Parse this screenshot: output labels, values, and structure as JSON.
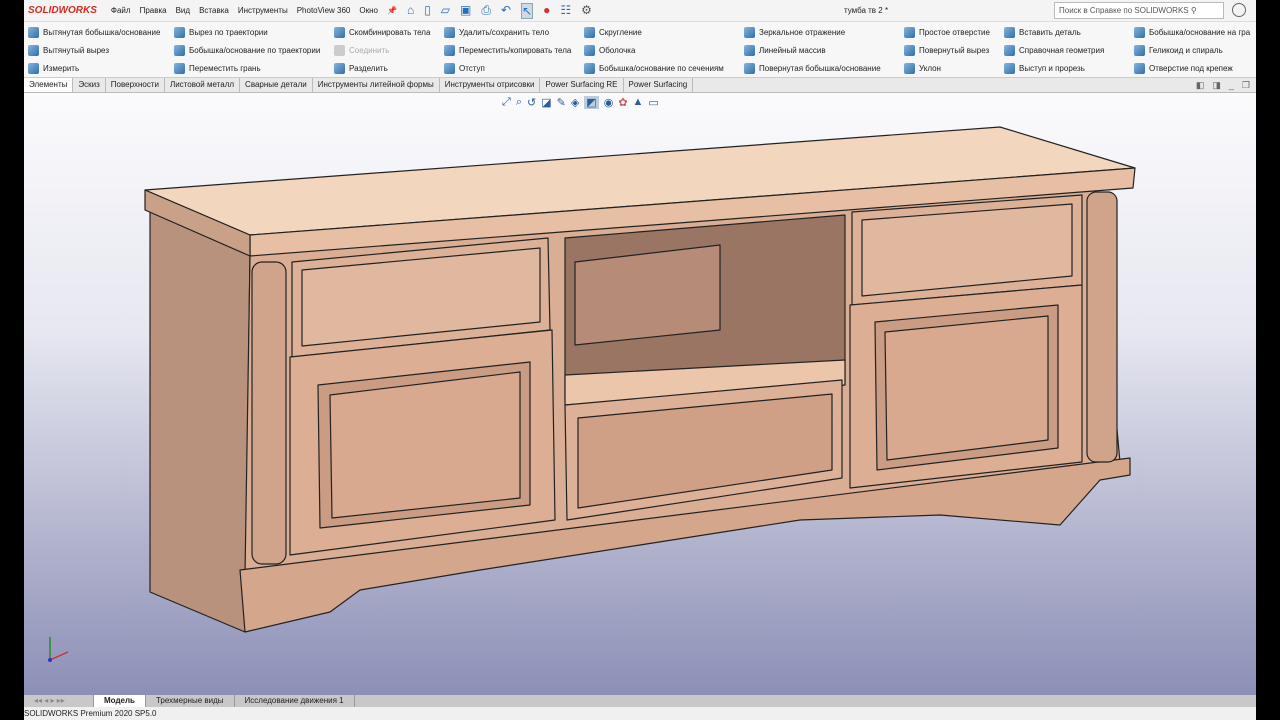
{
  "app": {
    "logo": "SOLIDWORKS",
    "title": "тумба тв 2 *"
  },
  "menu": [
    "Файл",
    "Правка",
    "Вид",
    "Вставка",
    "Инструменты",
    "PhotoView 360",
    "Окно"
  ],
  "search": {
    "placeholder": "Поиск в Справке по SOLIDWORKS"
  },
  "ribbon": [
    {
      "label": "Вытянутая бобышка/основание",
      "col": 0,
      "row": 0
    },
    {
      "label": "Вытянутый вырез",
      "col": 0,
      "row": 1
    },
    {
      "label": "Измерить",
      "col": 0,
      "row": 2
    },
    {
      "label": "Вырез по траектории",
      "col": 1,
      "row": 0
    },
    {
      "label": "Бобышка/основание по траектории",
      "col": 1,
      "row": 1
    },
    {
      "label": "Переместить грань",
      "col": 1,
      "row": 2
    },
    {
      "label": "Скомбинировать тела",
      "col": 2,
      "row": 0
    },
    {
      "label": "Соединить",
      "col": 2,
      "row": 1,
      "disabled": true
    },
    {
      "label": "Разделить",
      "col": 2,
      "row": 2
    },
    {
      "label": "Удалить/сохранить тело",
      "col": 3,
      "row": 0
    },
    {
      "label": "Переместить/копировать тела",
      "col": 3,
      "row": 1
    },
    {
      "label": "Отступ",
      "col": 3,
      "row": 2
    },
    {
      "label": "Скругление",
      "col": 4,
      "row": 0
    },
    {
      "label": "Оболочка",
      "col": 4,
      "row": 1
    },
    {
      "label": "Бобышка/основание по сечениям",
      "col": 4,
      "row": 2
    },
    {
      "label": "Зеркальное отражение",
      "col": 5,
      "row": 0
    },
    {
      "label": "Линейный массив",
      "col": 5,
      "row": 1
    },
    {
      "label": "Повернутая бобышка/основание",
      "col": 5,
      "row": 2
    },
    {
      "label": "Простое отверстие",
      "col": 6,
      "row": 0
    },
    {
      "label": "Повернутый вырез",
      "col": 6,
      "row": 1
    },
    {
      "label": "Уклон",
      "col": 6,
      "row": 2
    },
    {
      "label": "Вставить деталь",
      "col": 7,
      "row": 0
    },
    {
      "label": "Справочная геометрия",
      "col": 7,
      "row": 1
    },
    {
      "label": "Выступ и прорезь",
      "col": 7,
      "row": 2
    },
    {
      "label": "Бобышка/основание на гра",
      "col": 8,
      "row": 0
    },
    {
      "label": "Геликоид и спираль",
      "col": 8,
      "row": 1
    },
    {
      "label": "Отверстие под крепеж",
      "col": 8,
      "row": 2
    }
  ],
  "tabs": [
    "Элементы",
    "Эскиз",
    "Поверхности",
    "Листовой металл",
    "Сварные детали",
    "Инструменты литейной формы",
    "Инструменты отрисовки",
    "Power Surfacing RE",
    "Power Surfacing"
  ],
  "bottom_tabs": [
    "Модель",
    "Трехмерные виды",
    "Исследование движения 1"
  ],
  "status": "SOLIDWORKS Premium 2020 SP5.0"
}
